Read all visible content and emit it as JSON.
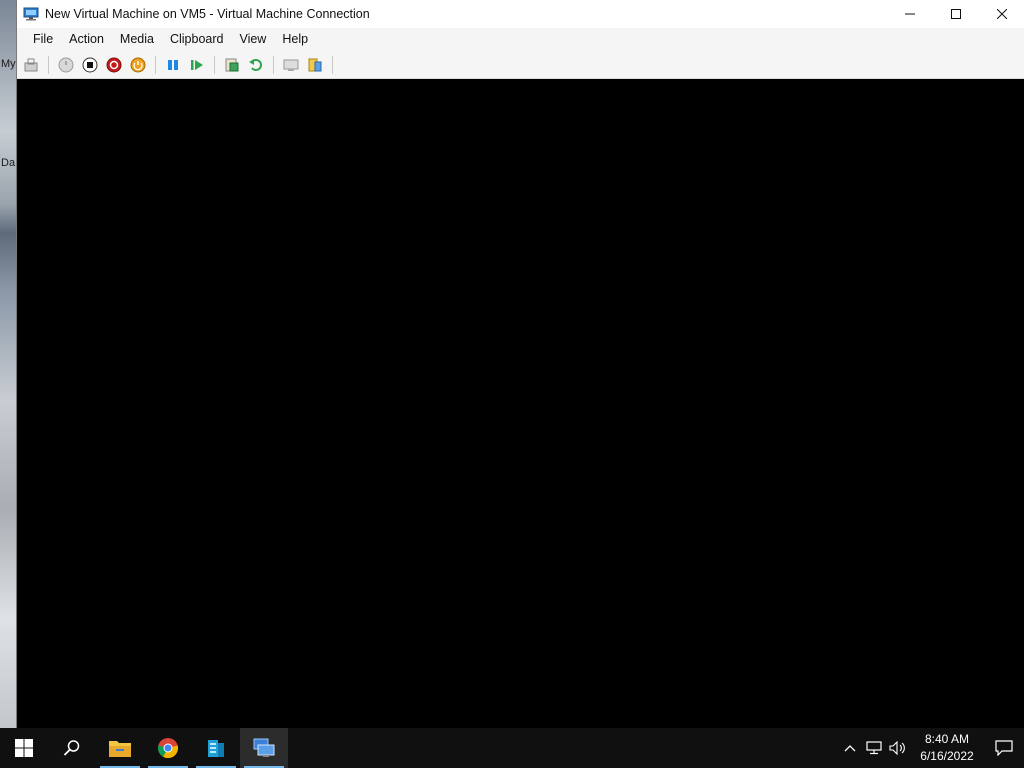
{
  "desktop": {
    "labels": [
      "My",
      "Da"
    ]
  },
  "window": {
    "title": "New Virtual Machine on VM5 - Virtual Machine Connection",
    "controls": {
      "minimize": "minimize-icon",
      "maximize": "maximize-icon",
      "close": "close-icon"
    }
  },
  "menu": {
    "items": [
      "File",
      "Action",
      "Media",
      "Clipboard",
      "View",
      "Help"
    ]
  },
  "toolbar": {
    "buttons": [
      "ctrl-alt-del-icon",
      "start-icon",
      "turn-off-icon",
      "shut-down-icon",
      "save-icon",
      "pause-icon",
      "reset-icon",
      "checkpoint-icon",
      "revert-icon",
      "enhanced-session-icon",
      "share-icon"
    ]
  },
  "taskbar": {
    "apps": [
      "start-icon",
      "search-icon",
      "file-explorer-icon",
      "chrome-icon",
      "server-manager-icon",
      "hyperv-connection-icon"
    ],
    "clock": {
      "time": "8:40 AM",
      "date": "6/16/2022"
    }
  },
  "colors": {
    "accent": "#76b9ed",
    "taskbar": "#101010",
    "vm_screen": "#000000"
  }
}
